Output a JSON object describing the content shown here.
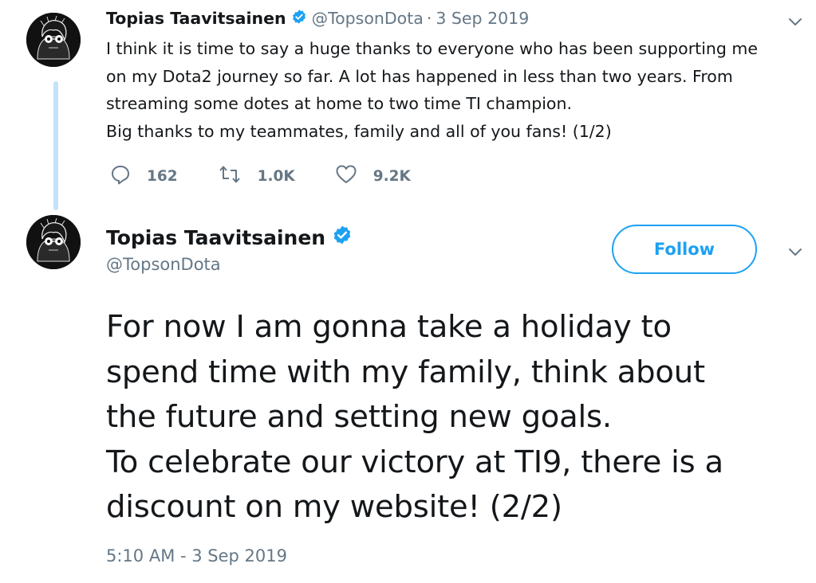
{
  "tweet1": {
    "author_name": "Topias Taavitsainen",
    "handle": "@TopsonDota",
    "separator": "·",
    "date": "3 Sep 2019",
    "text_lines": [
      "I think it is time to say a huge thanks to everyone who has been supporting me",
      "on my Dota2 journey so far. A lot has happened in less than two years. From",
      "streaming some dotes at home to two time TI champion.",
      "Big thanks to my teammates, family and all of you fans! (1/2)"
    ],
    "replies": "162",
    "retweets": "1.0K",
    "likes": "9.2K"
  },
  "tweet2": {
    "author_name": "Topias Taavitsainen",
    "handle": "@TopsonDota",
    "follow_label": "Follow",
    "text_lines": [
      "For now I am gonna take a holiday to",
      "spend time with my family, think about",
      "the future and setting new goals.",
      "To celebrate our victory at TI9, there is a",
      "discount on my website! (2/2)"
    ],
    "timestamp": "5:10 AM - 3 Sep 2019"
  },
  "icons": {
    "verified": "verified-badge-icon",
    "caret": "chevron-down-icon",
    "reply": "reply-icon",
    "retweet": "retweet-icon",
    "like": "heart-icon"
  },
  "colors": {
    "accent": "#1da1f2",
    "secondary_text": "#657786",
    "thread_line": "#c4e2f8"
  }
}
